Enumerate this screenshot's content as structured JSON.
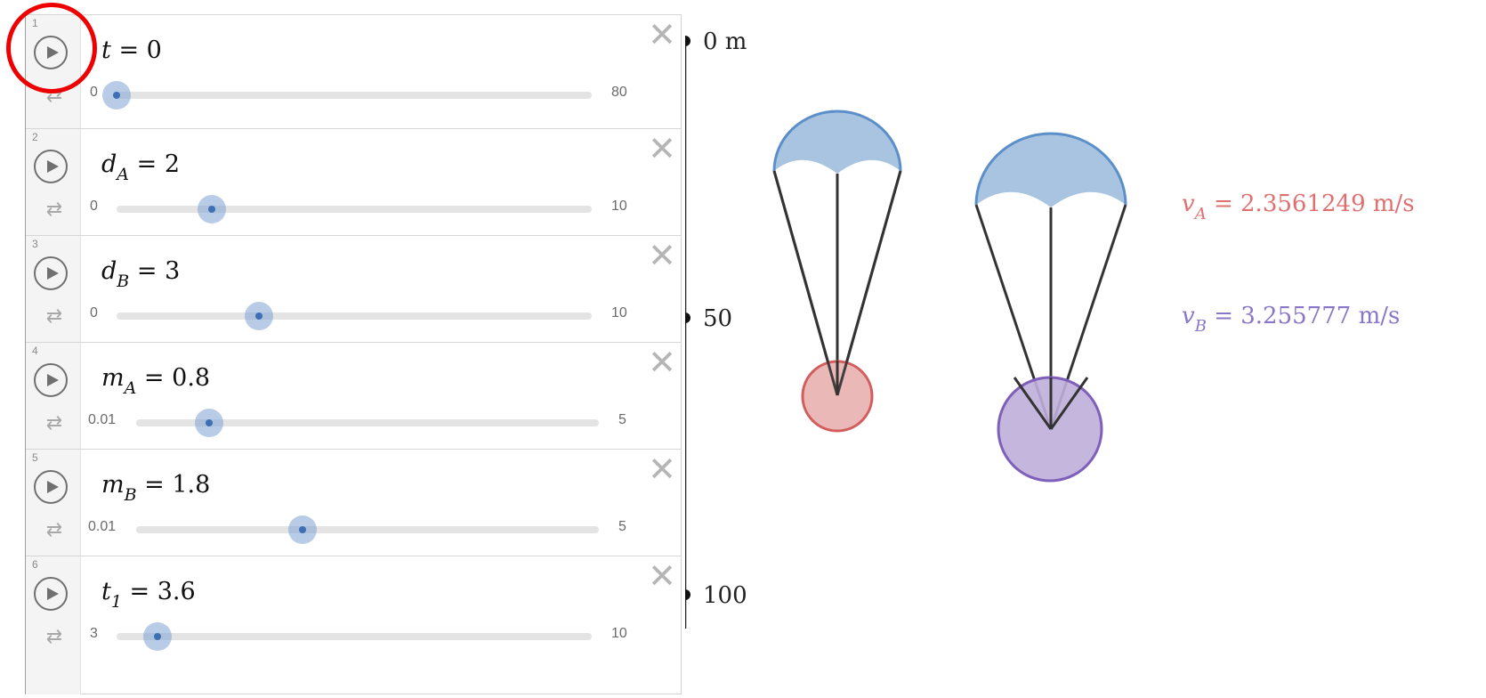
{
  "sliders": [
    {
      "num": "1",
      "var": "t",
      "sub": "",
      "eq": " = ",
      "value": "0",
      "min": "0",
      "max": "80",
      "frac": 0.0
    },
    {
      "num": "2",
      "var": "d",
      "sub": "A",
      "eq": " = ",
      "value": "2",
      "min": "0",
      "max": "10",
      "frac": 0.2
    },
    {
      "num": "3",
      "var": "d",
      "sub": "B",
      "eq": " = ",
      "value": "3",
      "min": "0",
      "max": "10",
      "frac": 0.3
    },
    {
      "num": "4",
      "var": "m",
      "sub": "A",
      "eq": " = ",
      "value": "0.8",
      "min": "0.01",
      "max": "5",
      "frac": 0.158
    },
    {
      "num": "5",
      "var": "m",
      "sub": "B",
      "eq": " = ",
      "value": "1.8",
      "min": "0.01",
      "max": "5",
      "frac": 0.359
    },
    {
      "num": "6",
      "var": "t",
      "sub": "1",
      "eq": " = ",
      "value": "3.6",
      "min": "3",
      "max": "10",
      "frac": 0.086
    }
  ],
  "icons": {
    "play": "play-icon",
    "loop": "repeat-icon",
    "delete": "close-icon"
  },
  "axis": {
    "labels": [
      "0 m",
      "50",
      "100"
    ]
  },
  "velocities": {
    "a": {
      "var": "v",
      "sub": "A",
      "text": " = 2.3561249 m/s",
      "color": "#e06f6f"
    },
    "b": {
      "var": "v",
      "sub": "B",
      "text": " = 3.255777 m/s",
      "color": "#8a76c8"
    }
  },
  "colors": {
    "canopy": "#a8c4e0",
    "canopy_stroke": "#5b8fc9",
    "mass_a": "#e9b0b0",
    "mass_a_stroke": "#d35d5d",
    "mass_b": "#bfaed9",
    "mass_b_stroke": "#7e5fba",
    "highlight": "#ee0000"
  }
}
